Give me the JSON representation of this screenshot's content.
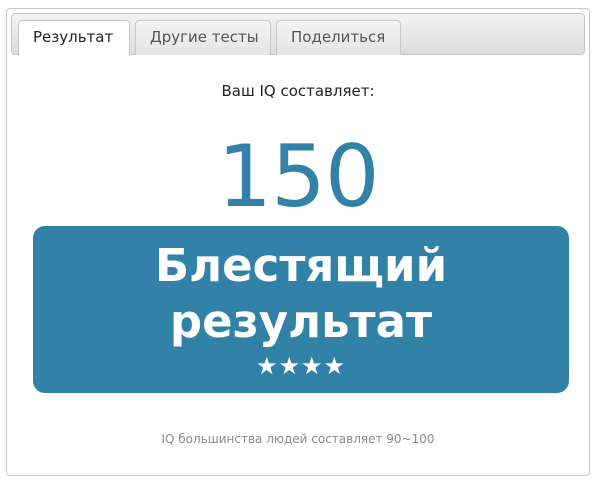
{
  "tabs": [
    {
      "label": "Результат",
      "active": true
    },
    {
      "label": "Другие тесты",
      "active": false
    },
    {
      "label": "Поделиться",
      "active": false
    }
  ],
  "result": {
    "lead": "Ваш IQ составляет:",
    "score": "150",
    "title_line1": "Блестящий",
    "title_line2": "результат",
    "stars": "★★★★",
    "star_count": 4,
    "box_color": "#3282a8",
    "score_color": "#3282a8"
  },
  "footnote": "IQ большинства людей составляет 90~100"
}
